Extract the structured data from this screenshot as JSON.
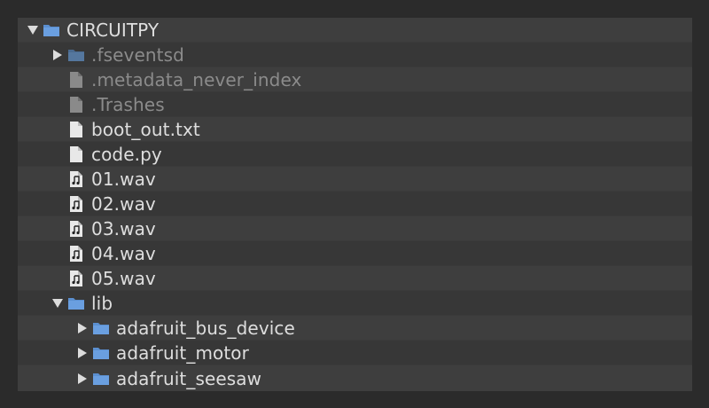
{
  "tree": {
    "items": [
      {
        "label": "CIRCUITPY",
        "type": "folder",
        "expanded": true,
        "hidden": false
      },
      {
        "label": ".fseventsd",
        "type": "folder",
        "expanded": false,
        "hidden": true
      },
      {
        "label": ".metadata_never_index",
        "type": "file",
        "hidden": true
      },
      {
        "label": ".Trashes",
        "type": "file",
        "hidden": true
      },
      {
        "label": "boot_out.txt",
        "type": "file",
        "hidden": false
      },
      {
        "label": "code.py",
        "type": "file",
        "hidden": false
      },
      {
        "label": "01.wav",
        "type": "audio-file",
        "hidden": false
      },
      {
        "label": "02.wav",
        "type": "audio-file",
        "hidden": false
      },
      {
        "label": "03.wav",
        "type": "audio-file",
        "hidden": false
      },
      {
        "label": "04.wav",
        "type": "audio-file",
        "hidden": false
      },
      {
        "label": "05.wav",
        "type": "audio-file",
        "hidden": false
      },
      {
        "label": "lib",
        "type": "folder",
        "expanded": true,
        "hidden": false
      },
      {
        "label": "adafruit_bus_device",
        "type": "folder",
        "expanded": false,
        "hidden": false
      },
      {
        "label": "adafruit_motor",
        "type": "folder",
        "expanded": false,
        "hidden": false
      },
      {
        "label": "adafruit_seesaw",
        "type": "folder",
        "expanded": false,
        "hidden": false
      }
    ]
  },
  "colors": {
    "background": "#2b2b2b",
    "row_odd": "#3e3e3e",
    "row_even": "#373737",
    "text": "#dedede",
    "text_dim": "#8b8b8b",
    "folder": "#5b8fd0",
    "folder_dim": "#4a6a8f",
    "file": "#e8e8e8",
    "file_dim": "#8a8a8a"
  }
}
